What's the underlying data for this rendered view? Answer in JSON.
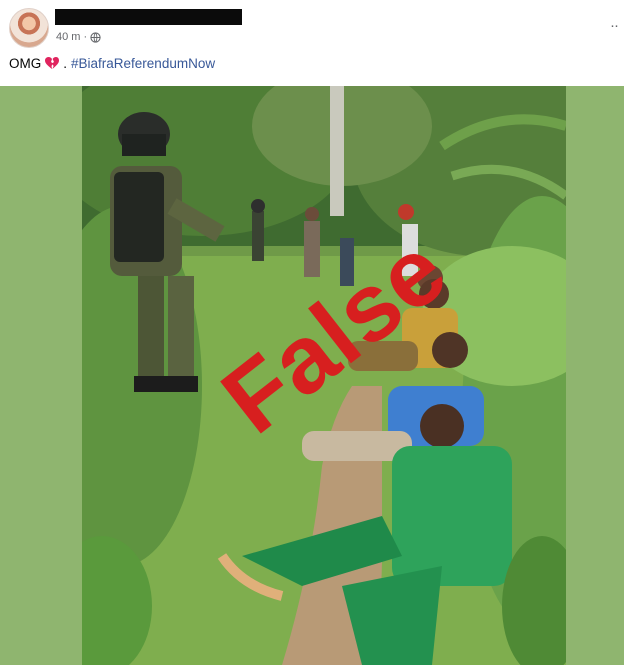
{
  "post": {
    "timestamp": "40 m",
    "separator": "·",
    "more_label": "··",
    "caption_text": "OMG",
    "caption_after_emoji": ".",
    "hashtag": "#BiafraReferendumNow"
  },
  "photo": {
    "stamp_text": "False",
    "stamp_color": "#d71f1f"
  },
  "icons": {
    "avatar": "profile-avatar",
    "globe": "globe-icon",
    "heart": "broken-heart-icon",
    "more": "more-options-icon"
  },
  "colors": {
    "hashtag": "#385898",
    "frame": "#8fb56f"
  }
}
